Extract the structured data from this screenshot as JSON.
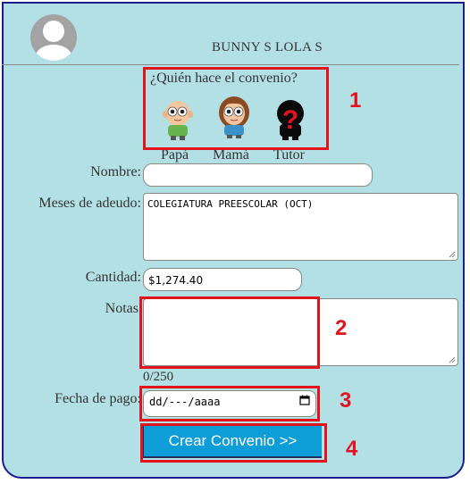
{
  "header": {
    "username": "BUNNY S LOLA S",
    "avatar_icon": "user-avatar-icon"
  },
  "agreement": {
    "question": "¿Quién hace el convenio?",
    "options": [
      {
        "label": "Papá",
        "icon": "dad-character-icon"
      },
      {
        "label": "Mamá",
        "icon": "mom-character-icon"
      },
      {
        "label": "Tutor",
        "icon": "tutor-unknown-icon"
      }
    ]
  },
  "form": {
    "nombre_label": "Nombre:",
    "nombre_value": "",
    "meses_label": "Meses de adeudo:",
    "meses_value": "COLEGIATURA PREESCOLAR (OCT)",
    "cantidad_label": "Cantidad:",
    "cantidad_value": "$1,274.40",
    "notas_label": "Notas",
    "notas_value": "",
    "notas_counter": "0/250",
    "fecha_label": "Fecha de pago:",
    "fecha_placeholder": "dd/---/aaaa",
    "submit_label": "Crear Convenio >>"
  },
  "annotations": {
    "labels": [
      "1",
      "2",
      "3",
      "4"
    ],
    "color": "#e1141e"
  },
  "colors": {
    "background": "#b3e0e5",
    "border": "#1a1d8c",
    "button": "#0d9ed8"
  }
}
